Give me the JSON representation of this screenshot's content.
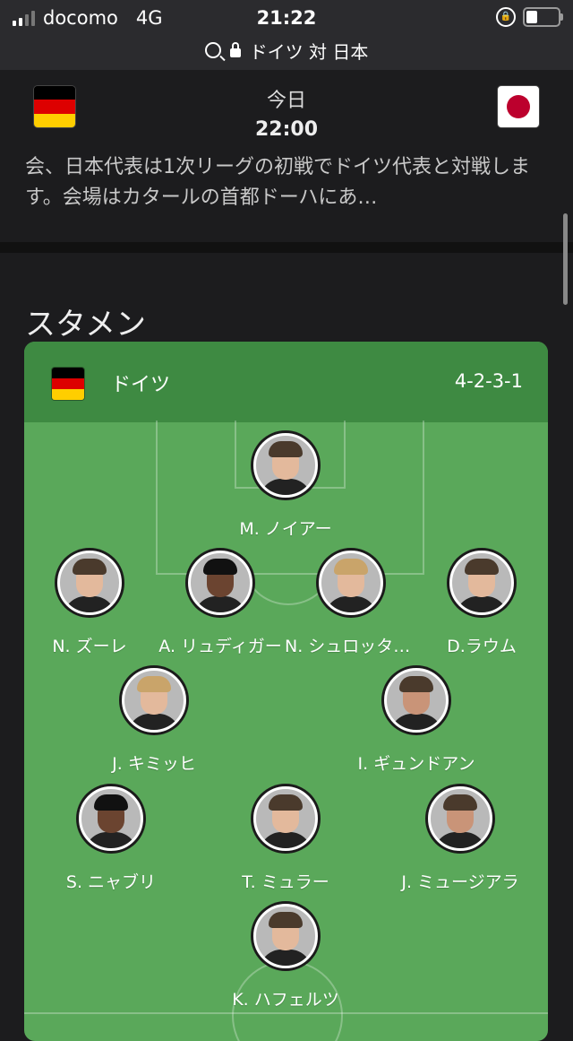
{
  "status_bar": {
    "carrier": "docomo",
    "network": "4G",
    "time": "21:22"
  },
  "url_bar": {
    "title": "ドイツ 対 日本"
  },
  "match_header": {
    "day": "今日",
    "kickoff": "22:00",
    "home_flag": "germany-flag",
    "away_flag": "japan-flag"
  },
  "article": {
    "text": "日本時間 【NHK】 サッカー ワールドカップ カタール大会、日本代表は1次リーグの初戦でドイツ代表と対戦します。会場はカタールの首都ドーハにあ…"
  },
  "lineup": {
    "section_title": "スタメン",
    "team_name": "ドイツ",
    "formation": "4-2-3-1",
    "colors": {
      "card": "#5aa85a",
      "header": "#3e8a42"
    },
    "players": [
      {
        "name": "M. ノイアー",
        "row": 1,
        "col": 2
      },
      {
        "name": "N. ズーレ",
        "row": 2,
        "col": 1
      },
      {
        "name": "A. リュディガー",
        "row": 2,
        "col": 2
      },
      {
        "name": "N. シュロッターベック",
        "row": 2,
        "col": 3
      },
      {
        "name": "D.ラウム",
        "row": 2,
        "col": 4
      },
      {
        "name": "J. キミッヒ",
        "row": 3,
        "col": 1
      },
      {
        "name": "I. ギュンドアン",
        "row": 3,
        "col": 2
      },
      {
        "name": "S. ニャブリ",
        "row": 4,
        "col": 1
      },
      {
        "name": "T. ミュラー",
        "row": 4,
        "col": 2
      },
      {
        "name": "J. ミュージアラ",
        "row": 4,
        "col": 3
      },
      {
        "name": "K. ハフェルツ",
        "row": 5,
        "col": 1
      }
    ]
  }
}
